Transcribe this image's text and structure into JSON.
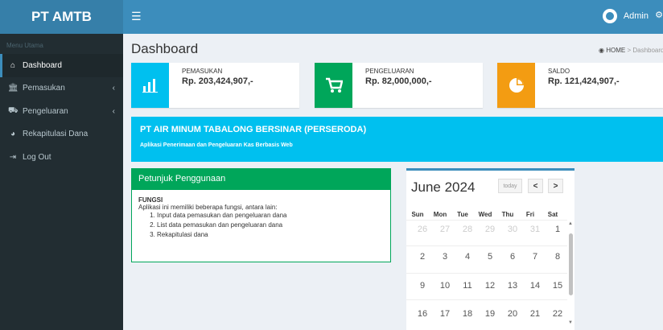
{
  "brand": {
    "logo": "PT AMTB"
  },
  "topbar": {
    "menu_icon": "☰",
    "user": "Admin"
  },
  "sidebar": {
    "header": "Menu Utama",
    "items": [
      {
        "label": "Dashboard",
        "icon": "home-icon"
      },
      {
        "label": "Pemasukan",
        "icon": "bank-icon",
        "chevron": "‹"
      },
      {
        "label": "Pengeluaran",
        "icon": "cart-icon",
        "chevron": "‹"
      },
      {
        "label": "Rekapitulasi Dana",
        "icon": "pie-chart-icon"
      },
      {
        "label": "Log Out",
        "icon": "sign-out-icon"
      }
    ]
  },
  "page": {
    "title": "Dashboard"
  },
  "breadcrumb": {
    "home": "HOME",
    "sep": ">",
    "current": "Dashboard"
  },
  "info_boxes": [
    {
      "label": "PEMASUKAN",
      "value": "Rp. 203,424,907,-",
      "color": "#00c0ef",
      "icon": "bar-chart-icon"
    },
    {
      "label": "PENGELUARAN",
      "value": "Rp. 82,000,000,-",
      "color": "#00a65a",
      "icon": "cart-icon"
    },
    {
      "label": "SALDO",
      "value": "Rp. 121,424,907,-",
      "color": "#f39c12",
      "icon": "pie-chart-icon"
    }
  ],
  "banner": {
    "title": "PT AIR MINUM TABALONG BERSINAR (PERSERODA)",
    "subtitle": "Aplikasi Penerimaan dan Pengeluaran Kas Berbasis Web"
  },
  "panel": {
    "title": "Petunjuk Penggunaan",
    "heading": "FUNGSI",
    "intro": "Aplikasi ini memiliki beberapa fungsi, antara lain:",
    "items": [
      "Input data pemasukan dan pengeluaran dana",
      "List data pemasukan dan pengeluaran dana",
      "Rekapitulasi dana"
    ]
  },
  "calendar": {
    "title": "June 2024",
    "today": "today",
    "prev": "<",
    "next": ">",
    "days_of_week": [
      "Sun",
      "Mon",
      "Tue",
      "Wed",
      "Thu",
      "Fri",
      "Sat"
    ],
    "weeks": [
      [
        "26",
        "27",
        "28",
        "29",
        "30",
        "31",
        "1"
      ],
      [
        "2",
        "3",
        "4",
        "5",
        "6",
        "7",
        "8"
      ],
      [
        "9",
        "10",
        "11",
        "12",
        "13",
        "14",
        "15"
      ],
      [
        "16",
        "17",
        "18",
        "19",
        "20",
        "21",
        "22"
      ]
    ]
  }
}
